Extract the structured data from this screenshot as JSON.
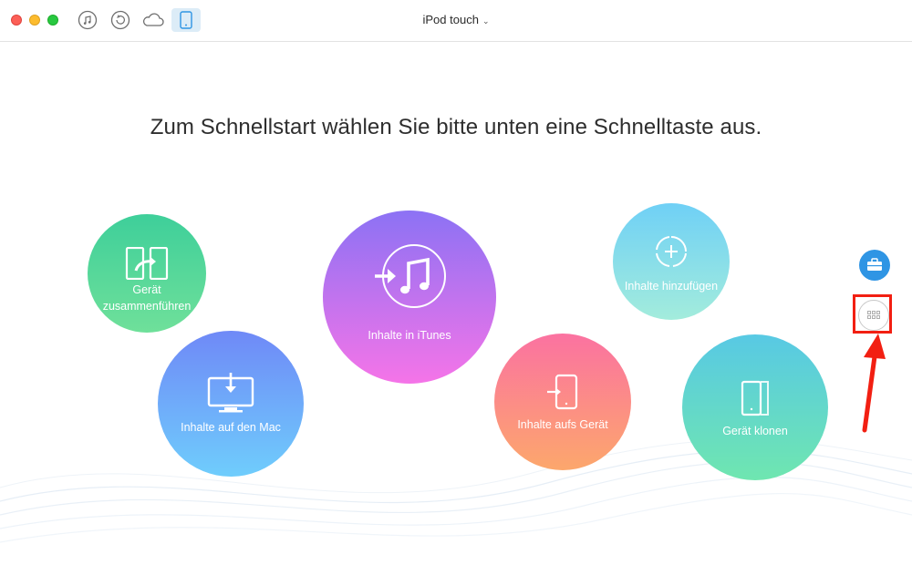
{
  "window": {
    "device_title": "iPod touch"
  },
  "toolbar": {
    "icons": [
      "music-icon",
      "restore-icon",
      "cloud-icon",
      "device-icon"
    ]
  },
  "main": {
    "headline": "Zum Schnellstart wählen Sie bitte unten eine Schnelltaste aus."
  },
  "shortcuts": {
    "merge": {
      "label_line1": "Gerät",
      "label_line2": "zusammenführen",
      "icon": "merge-devices-icon"
    },
    "mac": {
      "label": "Inhalte auf den Mac",
      "icon": "monitor-download-icon"
    },
    "itunes": {
      "label": "Inhalte in iTunes",
      "icon": "itunes-music-icon"
    },
    "device": {
      "label": "Inhalte aufs Gerät",
      "icon": "device-import-icon"
    },
    "add": {
      "label": "Inhalte hinzufügen",
      "icon": "add-content-icon"
    },
    "clone": {
      "label": "Gerät klonen",
      "icon": "clone-device-icon"
    }
  },
  "sidebar": {
    "icons": [
      "toolbox-icon",
      "grid-icon"
    ]
  },
  "colors": {
    "annotation": "#f21f12",
    "accent": "#2f95e4"
  }
}
